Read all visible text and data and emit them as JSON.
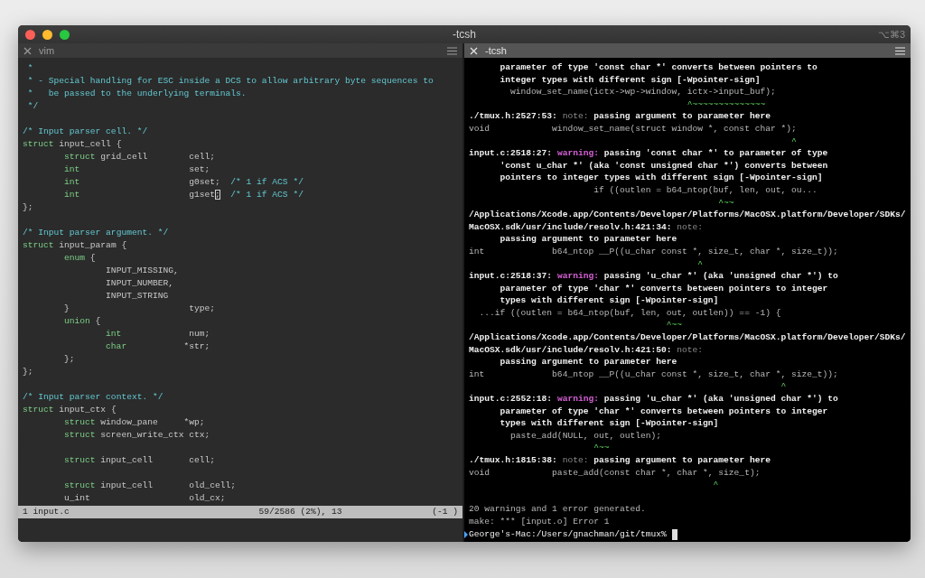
{
  "window": {
    "title": "-tcsh",
    "shortcut": "⌥⌘3"
  },
  "panes": [
    {
      "kind": "editor",
      "tab": {
        "label": "vim",
        "selected": false
      },
      "lines": [
        {
          "kind": "code",
          "segs": [
            {
              "kind": "comment",
              "t": " *"
            }
          ]
        },
        {
          "kind": "code",
          "segs": [
            {
              "kind": "comment",
              "t": " * - Special handling for ESC inside a DCS to allow arbitrary byte sequences to"
            }
          ]
        },
        {
          "kind": "code",
          "segs": [
            {
              "kind": "comment",
              "t": " *   be passed to the underlying terminals."
            }
          ]
        },
        {
          "kind": "code",
          "segs": [
            {
              "kind": "comment",
              "t": " */"
            }
          ]
        },
        {
          "kind": "blank"
        },
        {
          "kind": "code",
          "segs": [
            {
              "kind": "comment",
              "t": "/* Input parser cell. */"
            }
          ]
        },
        {
          "kind": "code",
          "segs": [
            {
              "kind": "keyword",
              "t": "struct"
            },
            {
              "kind": "plain",
              "t": " input_cell {"
            }
          ]
        },
        {
          "kind": "indent1",
          "segs": [
            {
              "kind": "keyword",
              "t": "struct"
            },
            {
              "kind": "plain",
              "t": " grid_cell        cell;"
            }
          ]
        },
        {
          "kind": "indent1",
          "segs": [
            {
              "kind": "keyword",
              "t": "int"
            },
            {
              "kind": "plain",
              "t": "                     set;"
            }
          ]
        },
        {
          "kind": "indent1",
          "segs": [
            {
              "kind": "keyword",
              "t": "int"
            },
            {
              "kind": "plain",
              "t": "                     g0set;  "
            },
            {
              "kind": "comment",
              "t": "/* 1 if ACS */"
            }
          ]
        },
        {
          "kind": "indent1",
          "segs": [
            {
              "kind": "keyword",
              "t": "int"
            },
            {
              "kind": "plain",
              "t": "                     g1set"
            },
            {
              "kind": "cursor",
              "t": ";"
            },
            {
              "kind": "comment",
              "t": "  /* 1 if ACS */"
            }
          ]
        },
        {
          "kind": "code",
          "segs": [
            {
              "kind": "plain",
              "t": "};"
            }
          ]
        },
        {
          "kind": "blank"
        },
        {
          "kind": "code",
          "segs": [
            {
              "kind": "comment",
              "t": "/* Input parser argument. */"
            }
          ]
        },
        {
          "kind": "code",
          "segs": [
            {
              "kind": "keyword",
              "t": "struct"
            },
            {
              "kind": "plain",
              "t": " input_param {"
            }
          ]
        },
        {
          "kind": "indent1",
          "segs": [
            {
              "kind": "keyword",
              "t": "enum"
            },
            {
              "kind": "plain",
              "t": " {"
            }
          ]
        },
        {
          "kind": "code",
          "segs": [
            {
              "kind": "plain",
              "t": "                INPUT_MISSING,"
            }
          ]
        },
        {
          "kind": "code",
          "segs": [
            {
              "kind": "plain",
              "t": "                INPUT_NUMBER,"
            }
          ]
        },
        {
          "kind": "code",
          "segs": [
            {
              "kind": "plain",
              "t": "                INPUT_STRING"
            }
          ]
        },
        {
          "kind": "code",
          "segs": [
            {
              "kind": "plain",
              "t": "        }                       type;"
            }
          ]
        },
        {
          "kind": "indent1",
          "segs": [
            {
              "kind": "keyword",
              "t": "union"
            },
            {
              "kind": "plain",
              "t": " {"
            }
          ]
        },
        {
          "kind": "indent2",
          "segs": [
            {
              "kind": "keyword",
              "t": "int"
            },
            {
              "kind": "plain",
              "t": "             num;"
            }
          ]
        },
        {
          "kind": "indent2",
          "segs": [
            {
              "kind": "keyword",
              "t": "char"
            },
            {
              "kind": "plain",
              "t": "           *str;"
            }
          ]
        },
        {
          "kind": "code",
          "segs": [
            {
              "kind": "plain",
              "t": "        };"
            }
          ]
        },
        {
          "kind": "code",
          "segs": [
            {
              "kind": "plain",
              "t": "};"
            }
          ]
        },
        {
          "kind": "blank"
        },
        {
          "kind": "code",
          "segs": [
            {
              "kind": "comment",
              "t": "/* Input parser context. */"
            }
          ]
        },
        {
          "kind": "code",
          "segs": [
            {
              "kind": "keyword",
              "t": "struct"
            },
            {
              "kind": "plain",
              "t": " input_ctx {"
            }
          ]
        },
        {
          "kind": "indent1",
          "segs": [
            {
              "kind": "keyword",
              "t": "struct"
            },
            {
              "kind": "plain",
              "t": " window_pane     *wp;"
            }
          ]
        },
        {
          "kind": "indent1",
          "segs": [
            {
              "kind": "keyword",
              "t": "struct"
            },
            {
              "kind": "plain",
              "t": " screen_write_ctx ctx;"
            }
          ]
        },
        {
          "kind": "blank"
        },
        {
          "kind": "indent1",
          "segs": [
            {
              "kind": "keyword",
              "t": "struct"
            },
            {
              "kind": "plain",
              "t": " input_cell       cell;"
            }
          ]
        },
        {
          "kind": "blank"
        },
        {
          "kind": "indent1",
          "segs": [
            {
              "kind": "keyword",
              "t": "struct"
            },
            {
              "kind": "plain",
              "t": " input_cell       old_cell;"
            }
          ]
        },
        {
          "kind": "code",
          "segs": [
            {
              "kind": "plain",
              "t": "        u_int                   old_cx;"
            }
          ]
        }
      ],
      "status_bar": {
        "file": "1 input.c",
        "position": "59/2586 (2%), 13",
        "mode": "(-1 )"
      }
    },
    {
      "kind": "terminal",
      "tab": {
        "label": "-tcsh",
        "selected": true
      },
      "lines": [
        {
          "kind": "code",
          "segs": [
            {
              "kind": "bold",
              "t": "      parameter of type 'const char *' converts between pointers to"
            }
          ]
        },
        {
          "kind": "code",
          "segs": [
            {
              "kind": "bold",
              "t": "      integer types with different sign [-Wpointer-sign]"
            }
          ]
        },
        {
          "kind": "code",
          "segs": [
            {
              "kind": "source",
              "t": "        window_set_name(ictx->wp->window, ictx->input_buf);"
            }
          ]
        },
        {
          "kind": "code",
          "segs": [
            {
              "kind": "caret",
              "t": "                                          ^~~~~~~~~~~~~~~"
            }
          ]
        },
        {
          "kind": "code",
          "segs": [
            {
              "kind": "bold",
              "t": "./tmux.h:2527:53: "
            },
            {
              "kind": "note",
              "t": "note:"
            },
            {
              "kind": "bold",
              "t": " passing argument to parameter here"
            }
          ]
        },
        {
          "kind": "code",
          "segs": [
            {
              "kind": "source",
              "t": "void            window_set_name(struct window *, const char *);"
            }
          ]
        },
        {
          "kind": "code",
          "segs": [
            {
              "kind": "caret",
              "t": "                                                              ^"
            }
          ]
        },
        {
          "kind": "code",
          "segs": [
            {
              "kind": "bold",
              "t": "input.c:2518:27: "
            },
            {
              "kind": "warning",
              "t": "warning:"
            },
            {
              "kind": "bold",
              "t": " passing 'const char *' to parameter of type"
            }
          ]
        },
        {
          "kind": "code",
          "segs": [
            {
              "kind": "bold",
              "t": "      'const u_char *' (aka 'const unsigned char *') converts between"
            }
          ]
        },
        {
          "kind": "code",
          "segs": [
            {
              "kind": "bold",
              "t": "      pointers to integer types with different sign [-Wpointer-sign]"
            }
          ]
        },
        {
          "kind": "code",
          "segs": [
            {
              "kind": "source",
              "t": "                        if ((outlen = b64_ntop(buf, len, out, ou..."
            }
          ]
        },
        {
          "kind": "code",
          "segs": [
            {
              "kind": "caret",
              "t": "                                                ^~~"
            }
          ]
        },
        {
          "kind": "code",
          "segs": [
            {
              "kind": "bold",
              "t": "/Applications/Xcode.app/Contents/Developer/Platforms/MacOSX.platform/Developer/SDKs/"
            }
          ]
        },
        {
          "kind": "code",
          "segs": [
            {
              "kind": "bold",
              "t": "MacOSX.sdk/usr/include/resolv.h:421:34: "
            },
            {
              "kind": "note",
              "t": "note:"
            }
          ]
        },
        {
          "kind": "code",
          "segs": [
            {
              "kind": "bold",
              "t": "      passing argument to parameter here"
            }
          ]
        },
        {
          "kind": "code",
          "segs": [
            {
              "kind": "source",
              "t": "int             b64_ntop __P((u_char const *, size_t, char *, size_t));"
            }
          ]
        },
        {
          "kind": "code",
          "segs": [
            {
              "kind": "caret",
              "t": "                                            ^"
            }
          ]
        },
        {
          "kind": "code",
          "segs": [
            {
              "kind": "bold",
              "t": "input.c:2518:37: "
            },
            {
              "kind": "warning",
              "t": "warning:"
            },
            {
              "kind": "bold",
              "t": " passing 'u_char *' (aka 'unsigned char *') to"
            }
          ]
        },
        {
          "kind": "code",
          "segs": [
            {
              "kind": "bold",
              "t": "      parameter of type 'char *' converts between pointers to integer"
            }
          ]
        },
        {
          "kind": "code",
          "segs": [
            {
              "kind": "bold",
              "t": "      types with different sign [-Wpointer-sign]"
            }
          ]
        },
        {
          "kind": "code",
          "segs": [
            {
              "kind": "source",
              "t": "  ...if ((outlen = b64_ntop(buf, len, out, outlen)) == -1) {"
            }
          ]
        },
        {
          "kind": "code",
          "segs": [
            {
              "kind": "caret",
              "t": "                                      ^~~"
            }
          ]
        },
        {
          "kind": "code",
          "segs": [
            {
              "kind": "bold",
              "t": "/Applications/Xcode.app/Contents/Developer/Platforms/MacOSX.platform/Developer/SDKs/"
            }
          ]
        },
        {
          "kind": "code",
          "segs": [
            {
              "kind": "bold",
              "t": "MacOSX.sdk/usr/include/resolv.h:421:50: "
            },
            {
              "kind": "note",
              "t": "note:"
            }
          ]
        },
        {
          "kind": "code",
          "segs": [
            {
              "kind": "bold",
              "t": "      passing argument to parameter here"
            }
          ]
        },
        {
          "kind": "code",
          "segs": [
            {
              "kind": "source",
              "t": "int             b64_ntop __P((u_char const *, size_t, char *, size_t));"
            }
          ]
        },
        {
          "kind": "code",
          "segs": [
            {
              "kind": "caret",
              "t": "                                                            ^"
            }
          ]
        },
        {
          "kind": "code",
          "segs": [
            {
              "kind": "bold",
              "t": "input.c:2552:18: "
            },
            {
              "kind": "warning",
              "t": "warning:"
            },
            {
              "kind": "bold",
              "t": " passing 'u_char *' (aka 'unsigned char *') to"
            }
          ]
        },
        {
          "kind": "code",
          "segs": [
            {
              "kind": "bold",
              "t": "      parameter of type 'char *' converts between pointers to integer"
            }
          ]
        },
        {
          "kind": "code",
          "segs": [
            {
              "kind": "bold",
              "t": "      types with different sign [-Wpointer-sign]"
            }
          ]
        },
        {
          "kind": "code",
          "segs": [
            {
              "kind": "source",
              "t": "        paste_add(NULL, out, outlen);"
            }
          ]
        },
        {
          "kind": "code",
          "segs": [
            {
              "kind": "caret",
              "t": "                        ^~~"
            }
          ]
        },
        {
          "kind": "code",
          "segs": [
            {
              "kind": "bold",
              "t": "./tmux.h:1815:38: "
            },
            {
              "kind": "note",
              "t": "note:"
            },
            {
              "kind": "bold",
              "t": " passing argument to parameter here"
            }
          ]
        },
        {
          "kind": "code",
          "segs": [
            {
              "kind": "source",
              "t": "void            paste_add(const char *, char *, size_t);"
            }
          ]
        },
        {
          "kind": "code",
          "segs": [
            {
              "kind": "caret",
              "t": "                                               ^"
            }
          ]
        },
        {
          "kind": "blank"
        },
        {
          "kind": "code",
          "segs": [
            {
              "kind": "source",
              "t": "20 warnings and 1 error generated."
            }
          ]
        },
        {
          "kind": "code",
          "segs": [
            {
              "kind": "source",
              "t": "make: *** [input.o] Error 1"
            }
          ]
        }
      ],
      "prompt": "George's-Mac:/Users/gnachman/git/tmux%"
    }
  ]
}
